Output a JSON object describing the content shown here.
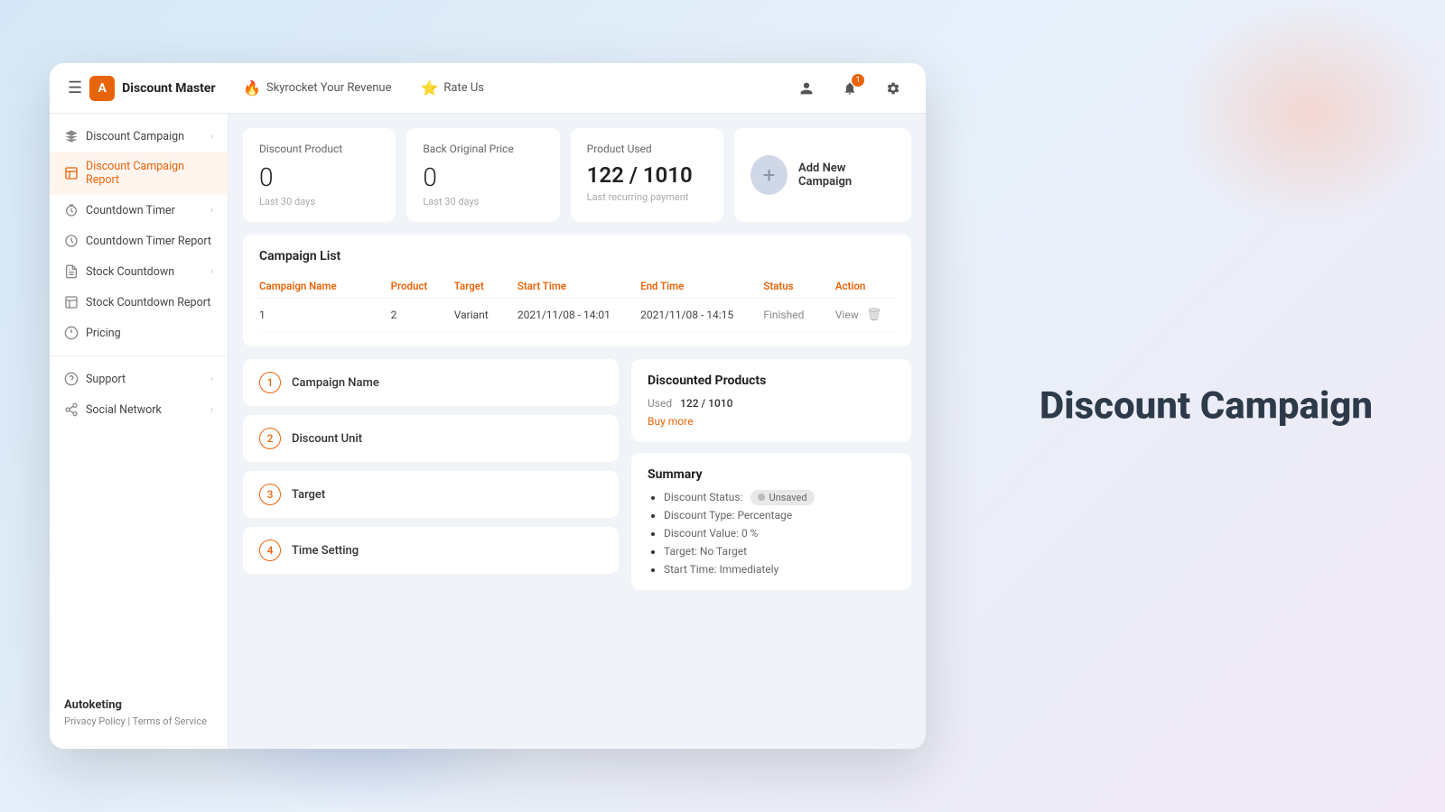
{
  "header": {
    "hamburger": "☰",
    "logo_letter": "A",
    "app_title": "Discount Master",
    "nav_items": [
      {
        "icon": "🔥",
        "label": "Skyrocket Your Revenue"
      },
      {
        "icon": "⭐",
        "label": "Rate Us"
      }
    ],
    "notification_count": "1"
  },
  "sidebar": {
    "items": [
      {
        "id": "discount-campaign",
        "label": "Discount Campaign",
        "has_arrow": true,
        "active": false
      },
      {
        "id": "discount-campaign-report",
        "label": "Discount Campaign Report",
        "has_arrow": false,
        "active": true
      },
      {
        "id": "countdown-timer",
        "label": "Countdown Timer",
        "has_arrow": true,
        "active": false
      },
      {
        "id": "countdown-timer-report",
        "label": "Countdown Timer Report",
        "has_arrow": false,
        "active": false
      },
      {
        "id": "stock-countdown",
        "label": "Stock Countdown",
        "has_arrow": true,
        "active": false
      },
      {
        "id": "stock-countdown-report",
        "label": "Stock Countdown Report",
        "has_arrow": false,
        "active": false
      },
      {
        "id": "pricing",
        "label": "Pricing",
        "has_arrow": false,
        "active": false
      }
    ],
    "section2": [
      {
        "id": "support",
        "label": "Support",
        "has_arrow": true
      },
      {
        "id": "social-network",
        "label": "Social Network",
        "has_arrow": true
      }
    ],
    "brand": "Autoketing",
    "privacy": "Privacy Policy",
    "separator": "|",
    "terms": "Terms of Service"
  },
  "stats": {
    "discount_product": {
      "label": "Discount Product",
      "value": "0",
      "sublabel": "Last 30 days"
    },
    "back_original_price": {
      "label": "Back Original Price",
      "value": "0",
      "sublabel": "Last 30 days"
    },
    "product_used": {
      "label": "Product Used",
      "value": "122 / 1010",
      "sublabel": "Last recurring payment"
    },
    "add_campaign": {
      "label": "Add New Campaign"
    }
  },
  "campaign_list": {
    "title": "Campaign List",
    "columns": [
      "Campaign Name",
      "Product",
      "Target",
      "Start Time",
      "End Time",
      "Status",
      "Action"
    ],
    "rows": [
      {
        "name": "1",
        "product": "2",
        "target": "Variant",
        "start_time": "2021/11/08 - 14:01",
        "end_time": "2021/11/08 - 14:15",
        "status": "Finished",
        "action_view": "View"
      }
    ]
  },
  "form_steps": [
    {
      "number": "1",
      "label": "Campaign Name"
    },
    {
      "number": "2",
      "label": "Discount Unit"
    },
    {
      "number": "3",
      "label": "Target"
    },
    {
      "number": "4",
      "label": "Time Setting"
    }
  ],
  "discounted_products": {
    "title": "Discounted Products",
    "used_label": "Used",
    "used_value": "122 / 1010",
    "buy_more": "Buy more"
  },
  "summary": {
    "title": "Summary",
    "items": [
      {
        "label": "Discount Status:",
        "value": "Unsaved",
        "badge": true
      },
      {
        "label": "Discount Type:",
        "value": "Percentage"
      },
      {
        "label": "Discount Value:",
        "value": "0 %"
      },
      {
        "label": "Target:",
        "value": "No Target"
      },
      {
        "label": "Start Time:",
        "value": "Immediately"
      }
    ]
  },
  "page_title": "Discount Campaign"
}
